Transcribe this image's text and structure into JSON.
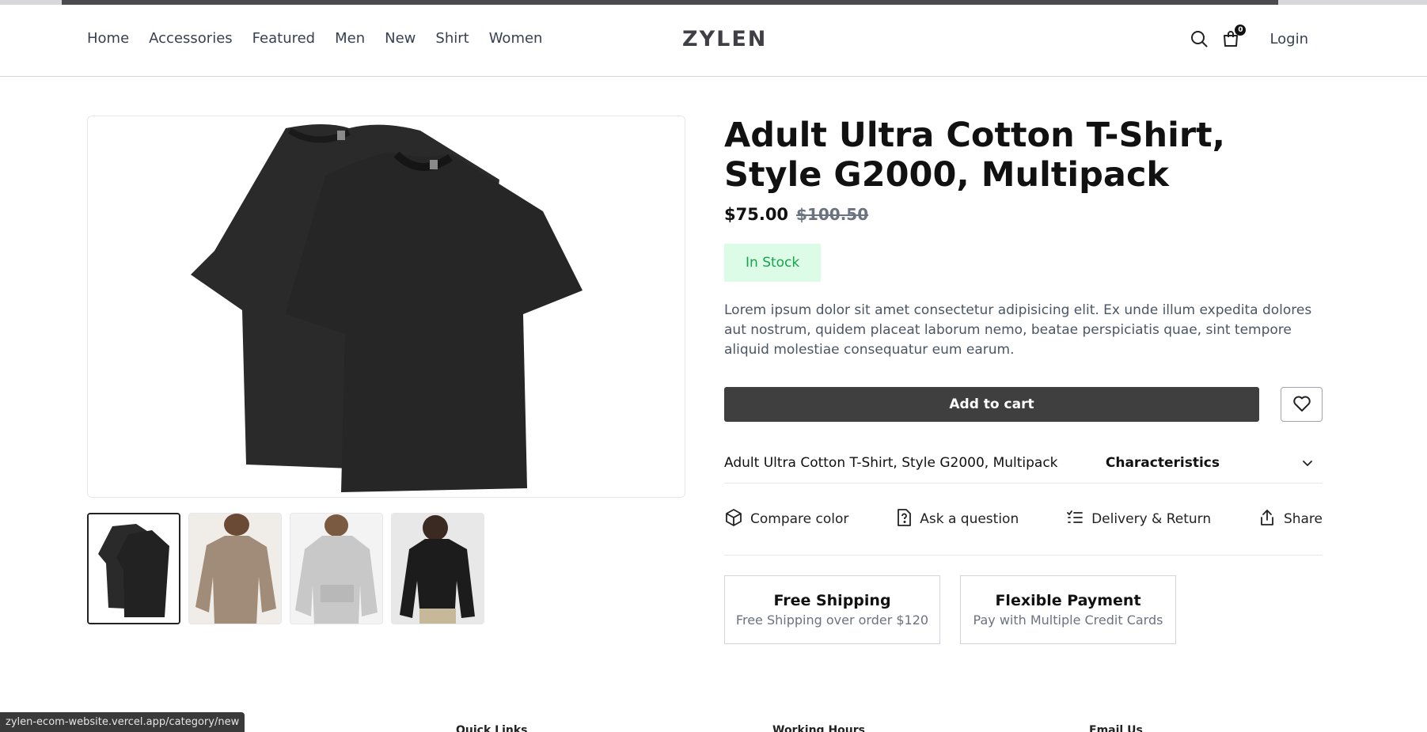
{
  "nav": {
    "menu": [
      "Home",
      "Accessories",
      "Featured",
      "Men",
      "New",
      "Shirt",
      "Women"
    ],
    "logo": "ZYLEN",
    "cart_count": "0",
    "login": "Login"
  },
  "product": {
    "title": "Adult Ultra Cotton T-Shirt, Style G2000, Multipack",
    "price": "$75.00",
    "old_price": "$100.50",
    "stock": "In Stock",
    "description": "Lorem ipsum dolor sit amet consectetur adipisicing elit. Ex unde illum expedita dolores aut nostrum, quidem placeat laborum nemo, beatae perspiciatis quae, sint tempore aliquid molestiae consequatur eum earum.",
    "add_to_cart": "Add to cart",
    "characteristics_name": "Adult Ultra Cotton T-Shirt, Style G2000, Multipack",
    "characteristics_label": "Characteristics"
  },
  "actions": [
    "Compare color",
    "Ask a question",
    "Delivery & Return",
    "Share"
  ],
  "features": [
    {
      "title": "Free Shipping",
      "subtitle": "Free Shipping over order $120"
    },
    {
      "title": "Flexible Payment",
      "subtitle": "Pay with Multiple Credit Cards"
    }
  ],
  "footer_headings": [
    "Quick Links",
    "Working Hours",
    "Email Us"
  ],
  "status_url": "zylen-ecom-website.vercel.app/category/new"
}
